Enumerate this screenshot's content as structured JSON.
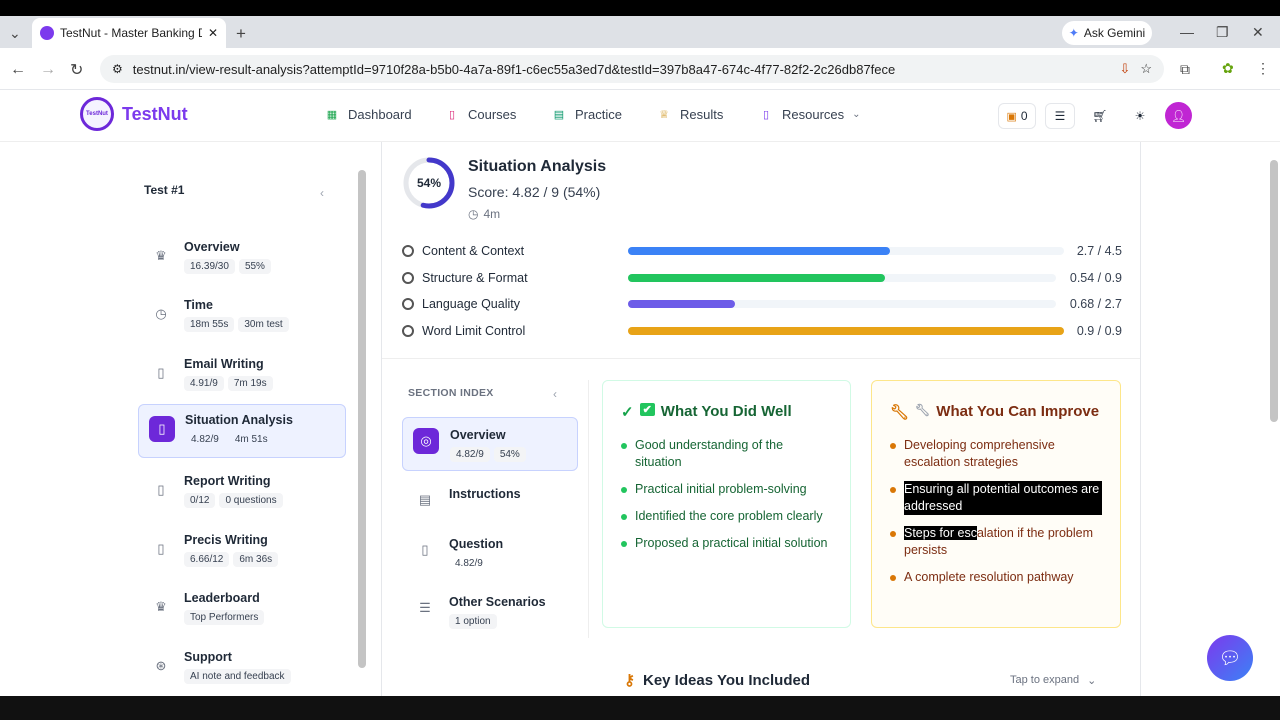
{
  "browser": {
    "tab_title": "TestNut - Master Banking Desc",
    "url": "testnut.in/view-result-analysis?attemptId=9710f28a-b5b0-4a7a-89f1-c6ec55a3ed7d&testId=397b8a47-674c-4f77-82f2-2c26db87fece",
    "gemini_label": "Ask Gemini"
  },
  "app": {
    "brand": "TestNut",
    "logo_text": "TestNut",
    "nav": [
      "Dashboard",
      "Courses",
      "Practice",
      "Results",
      "Resources"
    ],
    "coins": "0"
  },
  "sidebar": {
    "title": "Test #1",
    "items": [
      {
        "label": "Overview",
        "meta1": "16.39/30",
        "meta2": "55%",
        "icon": "trophy-icon"
      },
      {
        "label": "Time",
        "meta1": "18m 55s",
        "meta2": "30m test",
        "icon": "clock-icon"
      },
      {
        "label": "Email Writing",
        "meta1": "4.91/9",
        "meta2": "7m 19s",
        "icon": "book-icon"
      },
      {
        "label": "Situation Analysis",
        "meta1": "4.82/9",
        "meta2": "4m 51s",
        "icon": "book-icon"
      },
      {
        "label": "Report Writing",
        "meta1": "0/12",
        "meta2": "0 questions",
        "icon": "book-icon"
      },
      {
        "label": "Precis Writing",
        "meta1": "6.66/12",
        "meta2": "6m 36s",
        "icon": "book-icon"
      },
      {
        "label": "Leaderboard",
        "meta1": "Top Performers",
        "icon": "trophy-icon"
      },
      {
        "label": "Support",
        "meta1": "AI note and feedback",
        "icon": "lifebuoy-icon"
      }
    ]
  },
  "section": {
    "ring_label": "54%",
    "ring_value": 0.54,
    "title": "Situation Analysis",
    "score": "Score: 4.82 / 9 (54%)",
    "duration": "4m",
    "criteria": [
      {
        "label": "Content & Context",
        "value": "2.7 / 4.5",
        "fraction": 0.6,
        "color": "#3b82f6"
      },
      {
        "label": "Structure & Format",
        "value": "0.54 / 0.9",
        "fraction": 0.6,
        "color": "#22c55e"
      },
      {
        "label": "Language Quality",
        "value": "0.68 / 2.7",
        "fraction": 0.25,
        "color": "#6d5ce8"
      },
      {
        "label": "Word Limit Control",
        "value": "0.9 / 0.9",
        "fraction": 1.0,
        "color": "#e8a317"
      }
    ]
  },
  "section_index": {
    "title": "SECTION INDEX",
    "items": [
      {
        "label": "Overview",
        "meta1": "4.82/9",
        "meta2": "54%"
      },
      {
        "label": "Instructions"
      },
      {
        "label": "Question",
        "meta1": "4.82/9"
      },
      {
        "label": "Other Scenarios",
        "meta1": "1 option"
      }
    ]
  },
  "well": {
    "title": "What You Did Well",
    "items": [
      "Good understanding of the situation",
      "Practical initial problem-solving",
      "Identified the core problem clearly",
      "Proposed a practical initial solution"
    ]
  },
  "improve": {
    "title": "What You Can Improve",
    "items": [
      "Developing comprehensive escalation strategies",
      "Ensuring all potential outcomes are addressed",
      "Steps for escalation if the problem persists",
      "A complete resolution pathway"
    ],
    "item3_hl": "Steps for esc",
    "item3_rest": "alation if the problem persists"
  },
  "key_ideas": {
    "title": "Key Ideas You Included",
    "toggle": "Tap to expand"
  }
}
